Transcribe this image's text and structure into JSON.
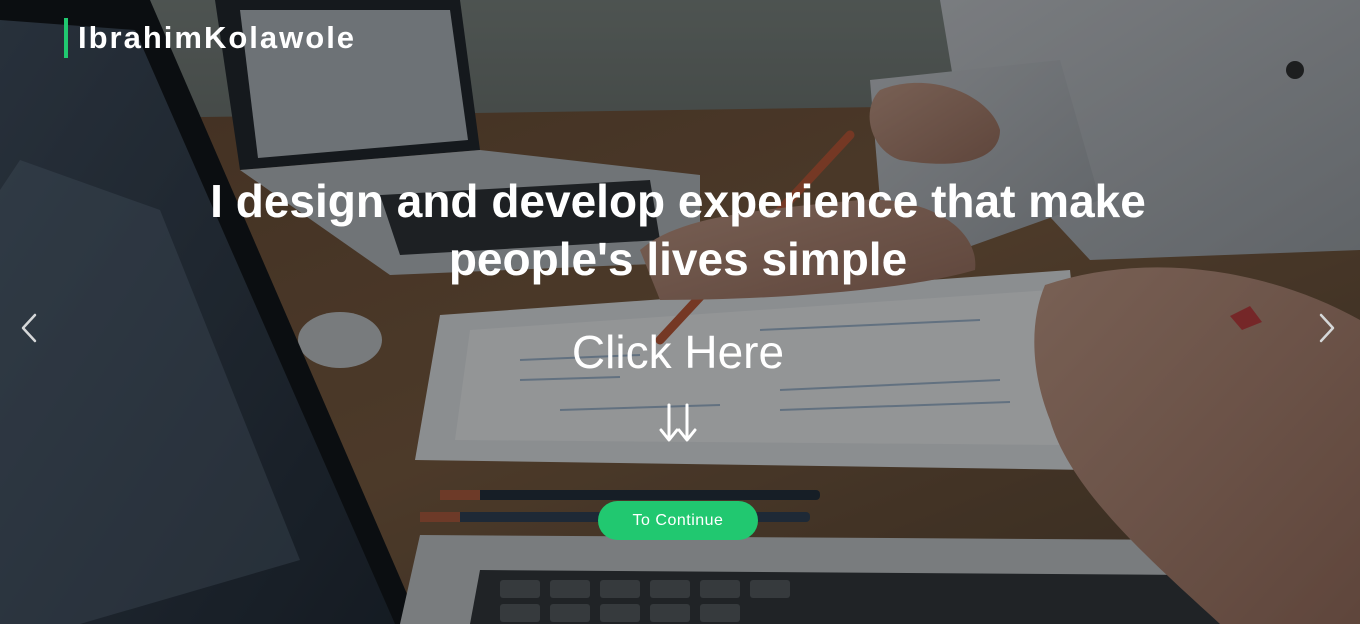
{
  "brand": {
    "name": "IbrahimKolawole",
    "accent_color": "#21c870"
  },
  "hero": {
    "headline": "I design and develop experience that make people's lives simple",
    "click_here": "Click Here",
    "arrows_icon": "double-down-arrow-icon",
    "cta_label": "To Continue",
    "cta_color": "#21c870"
  },
  "carousel": {
    "prev_icon": "chevron-left-icon",
    "next_icon": "chevron-right-icon"
  }
}
